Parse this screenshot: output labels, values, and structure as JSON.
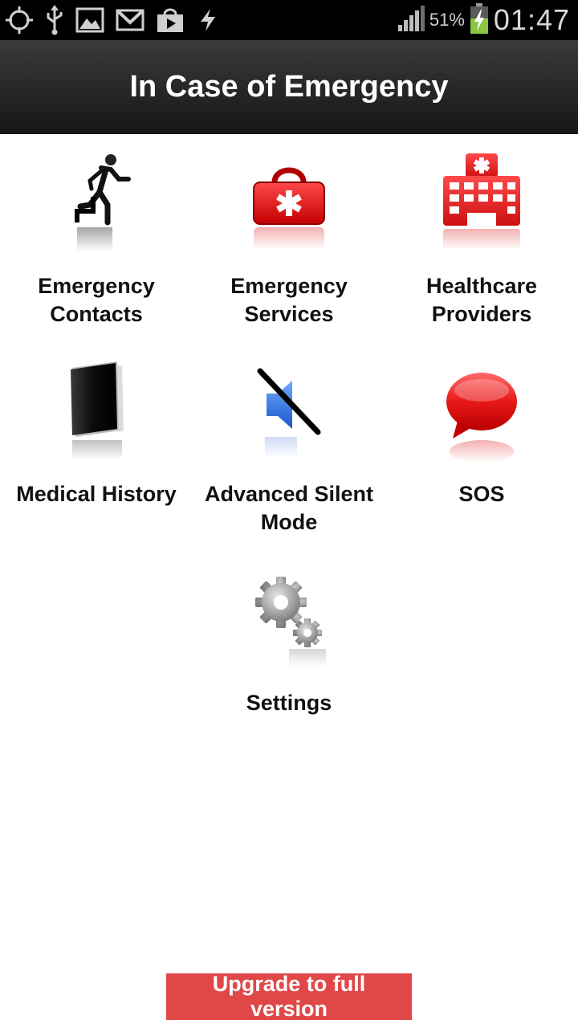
{
  "status_bar": {
    "icons": [
      "gps-icon",
      "usb-icon",
      "image-icon",
      "gmail-icon",
      "play-store-icon",
      "sync-icon",
      "signal-icon",
      "battery-charging-icon"
    ],
    "battery": "51%",
    "time": "01:47"
  },
  "header": {
    "title": "In Case of Emergency"
  },
  "menu": {
    "items": [
      {
        "label": "Emergency Contacts",
        "icon": "running-exit-icon"
      },
      {
        "label": "Emergency Services",
        "icon": "first-aid-kit-icon"
      },
      {
        "label": "Healthcare Providers",
        "icon": "hospital-icon"
      },
      {
        "label": "Medical History",
        "icon": "book-icon"
      },
      {
        "label": "Advanced Silent Mode",
        "icon": "muted-speaker-icon"
      },
      {
        "label": "SOS",
        "icon": "speech-bubble-icon"
      },
      {
        "label": "Settings",
        "icon": "gears-icon"
      }
    ]
  },
  "footer": {
    "upgrade_label": "Upgrade to full version",
    "upgrade_color": "#e04848"
  },
  "colors": {
    "accent_red": "#e02020",
    "title_bar": "#2a2a2a"
  }
}
